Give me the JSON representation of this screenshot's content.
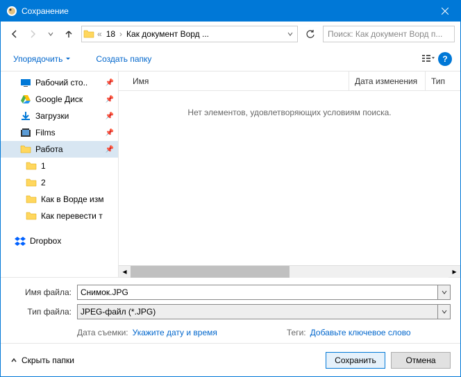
{
  "title": "Сохранение",
  "breadcrumb": {
    "seg1": "18",
    "seg2": "Как документ Ворд ..."
  },
  "search_placeholder": "Поиск: Как документ Ворд п...",
  "toolbar": {
    "organize": "Упорядочить",
    "new_folder": "Создать папку"
  },
  "sidebar": {
    "items": [
      {
        "label": "Рабочий сто..",
        "pinned": true
      },
      {
        "label": "Google Диск",
        "pinned": true
      },
      {
        "label": "Загрузки",
        "pinned": true
      },
      {
        "label": "Films",
        "pinned": true
      },
      {
        "label": "Работа",
        "pinned": true,
        "selected": true
      },
      {
        "label": "1"
      },
      {
        "label": "2"
      },
      {
        "label": "Как в Ворде изм"
      },
      {
        "label": "Как перевести т"
      }
    ],
    "dropbox": "Dropbox"
  },
  "columns": {
    "name": "Имя",
    "date": "Дата изменения",
    "type": "Тип"
  },
  "empty_msg": "Нет элементов, удовлетворяющих условиям поиска.",
  "form": {
    "filename_label": "Имя файла:",
    "filename_value": "Снимок.JPG",
    "filetype_label": "Тип файла:",
    "filetype_value": "JPEG-файл (*.JPG)",
    "date_label": "Дата съемки:",
    "date_link": "Укажите дату и время",
    "tags_label": "Теги:",
    "tags_link": "Добавьте ключевое слово"
  },
  "footer": {
    "hide": "Скрыть папки",
    "save": "Сохранить",
    "cancel": "Отмена"
  }
}
